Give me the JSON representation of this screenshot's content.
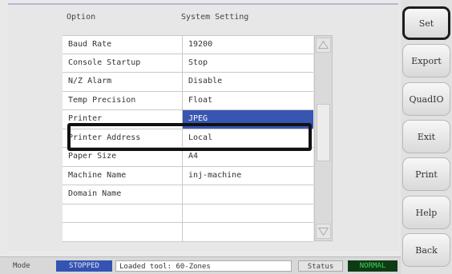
{
  "columns": {
    "option": "Option",
    "setting": "System Setting"
  },
  "rows": [
    {
      "option": "Baud Rate",
      "value": "19200"
    },
    {
      "option": "Console Startup",
      "value": "Stop"
    },
    {
      "option": "N/Z Alarm",
      "value": "Disable"
    },
    {
      "option": "Temp Precision",
      "value": "Float"
    },
    {
      "option": "Printer",
      "value": "JPEG",
      "selected": true
    },
    {
      "option": "Printer Address",
      "value": "Local"
    },
    {
      "option": "Paper Size",
      "value": "A4"
    },
    {
      "option": "Machine Name",
      "value": "inj-machine"
    },
    {
      "option": "Domain Name",
      "value": ""
    },
    {
      "option": "",
      "value": ""
    },
    {
      "option": "",
      "value": ""
    }
  ],
  "side_buttons": [
    {
      "label": "Set",
      "active": true
    },
    {
      "label": "Export"
    },
    {
      "label": "QuadIO"
    },
    {
      "label": "Exit"
    },
    {
      "label": "Print"
    },
    {
      "label": "Help"
    },
    {
      "label": "Back"
    }
  ],
  "status_bar": {
    "mode_label": "Mode",
    "mode_value": "STOPPED",
    "message": "Loaded tool: 60-Zones",
    "status_label": "Status",
    "status_value": "NORMAL"
  },
  "colors": {
    "selection": "#3855b2",
    "mode_badge": "#3453b3",
    "status_badge_bg": "#0f3b14",
    "status_badge_text": "#3fd35b"
  },
  "icons": {
    "scroll_up": "triangle-up-icon",
    "scroll_down": "triangle-down-icon"
  }
}
